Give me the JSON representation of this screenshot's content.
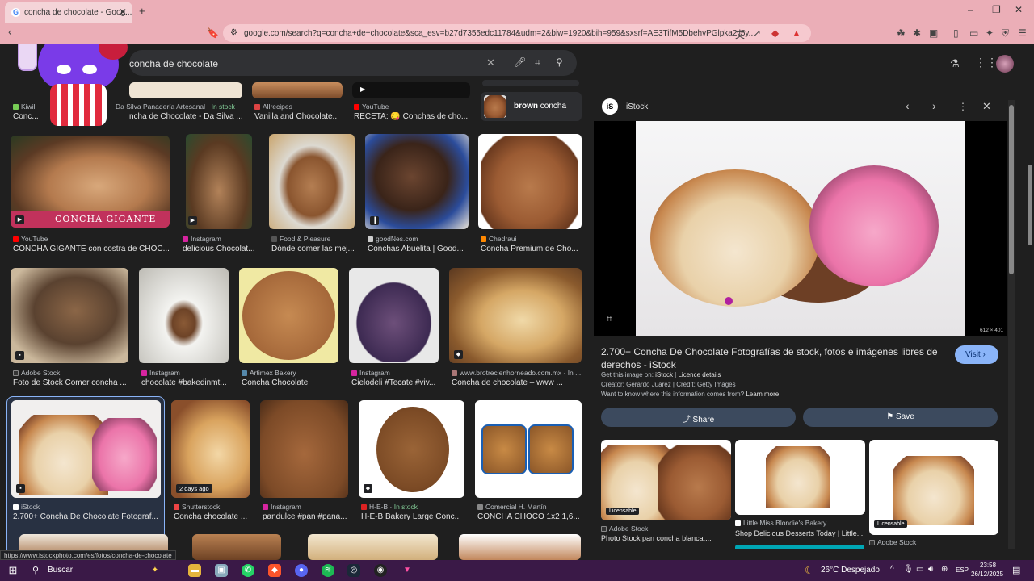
{
  "browser": {
    "tab_title": "concha de chocolate - Goog...",
    "url": "google.com/search?q=concha+de+chocolate&sca_esv=b27d7355edc11784&udm=2&biw=1920&bih=959&sxsrf=AE3TifM5DbehvPGlpka2li5y...",
    "colors": {
      "chrome": "#ebaeb7",
      "taskbar": "#3a1947"
    }
  },
  "search": {
    "query": "concha de chocolate"
  },
  "suggestion": {
    "text": "brown concha",
    "bold": "brown",
    "rest": " concha"
  },
  "top_row": [
    {
      "source": "Kiwili",
      "title": "Conc..."
    },
    {
      "source": "Da Silva Panadería Artesanal",
      "stock": "In stock",
      "title": "ncha de Chocolate - Da Silva ..."
    },
    {
      "source": "Allrecipes",
      "title": "Vanilla and Chocolate..."
    },
    {
      "source": "YouTube",
      "title": "RECETA: 😋 Conchas de cho..."
    }
  ],
  "row2": [
    {
      "source": "YouTube",
      "title": "CONCHA GIGANTE con costra de CHOC...",
      "overlay": "CONCHA GIGANTE"
    },
    {
      "source": "Instagram",
      "title": "delicious Chocolat..."
    },
    {
      "source": "Food & Pleasure",
      "title": "Dónde comer las mej..."
    },
    {
      "source": "goodNes.com",
      "title": "Conchas Abuelita | Good..."
    },
    {
      "source": "Chedraui",
      "title": "Concha Premium de Cho..."
    }
  ],
  "row3": [
    {
      "source": "Adobe Stock",
      "title": "Foto de Stock Comer concha ..."
    },
    {
      "source": "Instagram",
      "title": "chocolate #bakedinmt..."
    },
    {
      "source": "Artimex Bakery",
      "title": "Concha Chocolate"
    },
    {
      "source": "Instagram",
      "title": "Cielodeli #Tecate #viv..."
    },
    {
      "source": "www.brotrecienhorneado.com.mx · In ...",
      "title": "Concha de chocolate – www ..."
    }
  ],
  "row4": [
    {
      "source": "iStock",
      "title": "2.700+ Concha De Chocolate Fotograf..."
    },
    {
      "source": "Shutterstock",
      "title": "Concha chocolate ...",
      "badge": "2 days ago"
    },
    {
      "source": "Instagram",
      "title": "pandulce #pan #pana..."
    },
    {
      "source": "H-E-B",
      "stock": "In stock",
      "title": "H-E-B Bakery Large Conc..."
    },
    {
      "source": "Comercial H. Martín",
      "title": "CONCHA CHOCO 1x2 1,6..."
    }
  ],
  "panel": {
    "site": "iStock",
    "dimensions": "612 × 401",
    "title": "2.700+ Concha De Chocolate Fotografías de stock, fotos e imágenes libres de derechos - iStock",
    "visit": "Visit",
    "get_image_prefix": "Get this image on: ",
    "get_image_site": "iStock",
    "licence": "Licence details",
    "creator": "Creator: Gerardo Juarez | Credit: Getty Images",
    "want_to_know": "Want to know where this information comes from? ",
    "learn_more": "Learn more",
    "share": "Share",
    "save": "Save",
    "related": [
      {
        "badge": "Licensable",
        "source": "Adobe Stock",
        "title": "Photo Stock pan concha blanca,..."
      },
      {
        "source": "Little Miss Blondie's Bakery",
        "title": "Shop Delicious Desserts Today | Little..."
      },
      {
        "badge": "Licensable",
        "source": "Adobe Stock"
      }
    ]
  },
  "status_url": "https://www.istockphoto.com/es/fotos/concha-de-chocolate",
  "taskbar": {
    "search": "Buscar",
    "weather": "26°C  Despejado",
    "lang": "ESP",
    "time": "23:58",
    "date": "26/12/2025"
  }
}
